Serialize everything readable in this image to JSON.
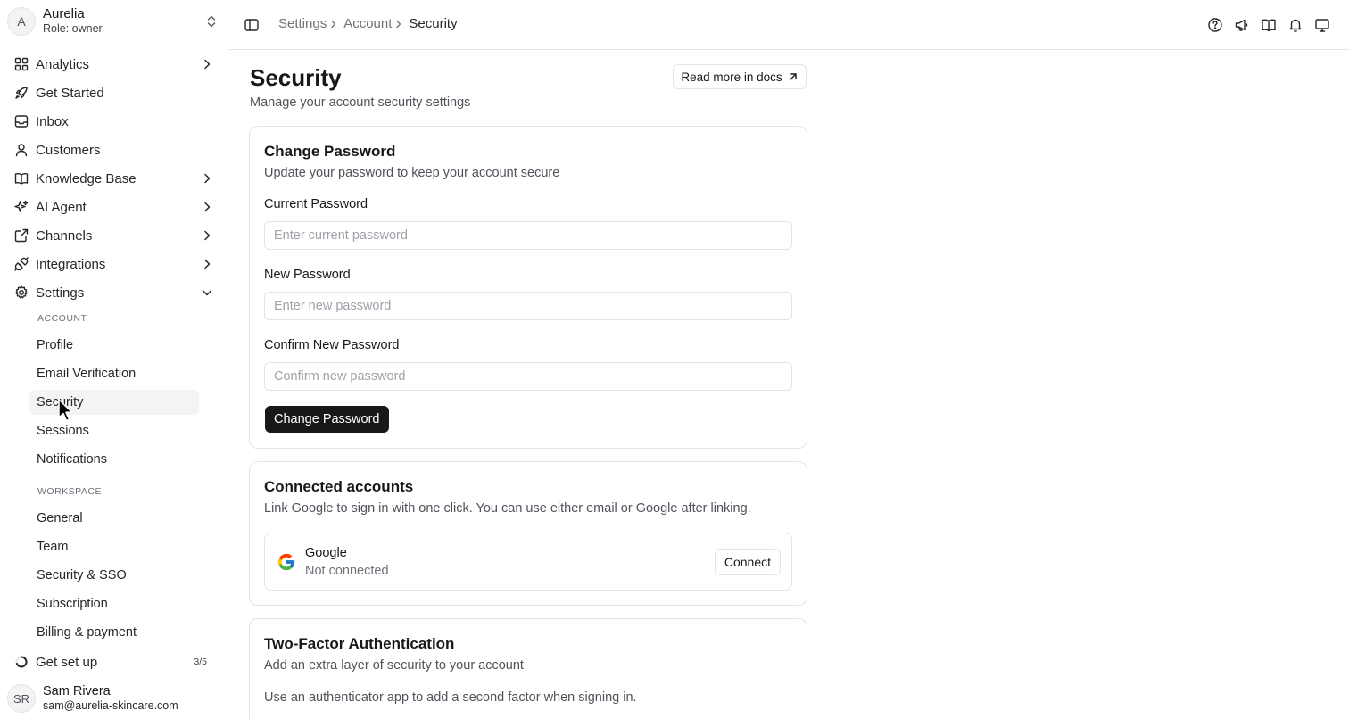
{
  "workspace": {
    "avatar_letter": "A",
    "name": "Aurelia",
    "role": "Role: owner"
  },
  "sidebar": {
    "items": [
      {
        "label": "Analytics",
        "icon": "grid-icon",
        "has_caret": true
      },
      {
        "label": "Get Started",
        "icon": "rocket-icon"
      },
      {
        "label": "Inbox",
        "icon": "inbox-icon"
      },
      {
        "label": "Customers",
        "icon": "user-icon"
      },
      {
        "label": "Knowledge Base",
        "icon": "book-icon",
        "has_caret": true
      },
      {
        "label": "AI Agent",
        "icon": "sparkles-icon",
        "has_caret": true
      },
      {
        "label": "Channels",
        "icon": "share-icon",
        "has_caret": true
      },
      {
        "label": "Integrations",
        "icon": "plug-icon",
        "has_caret": true
      },
      {
        "label": "Settings",
        "icon": "gear-icon",
        "expanded": true
      }
    ],
    "settings_sections": [
      {
        "heading": "Account",
        "items": [
          "Profile",
          "Email Verification",
          "Security",
          "Sessions",
          "Notifications"
        ]
      },
      {
        "heading": "Workspace",
        "items": [
          "General",
          "Team",
          "Security & SSO",
          "Subscription",
          "Billing & payment"
        ]
      }
    ],
    "active_item": "Security",
    "setup": {
      "label": "Get set up",
      "progress": "3/5"
    },
    "user": {
      "initials": "SR",
      "name": "Sam Rivera",
      "email": "sam@aurelia-skincare.com"
    }
  },
  "breadcrumb": [
    "Settings",
    "Account",
    "Security"
  ],
  "topbar_icons": [
    "help-icon",
    "megaphone-icon",
    "book-open-icon",
    "bell-icon",
    "monitor-icon"
  ],
  "page": {
    "title": "Security",
    "subtitle": "Manage your account security settings",
    "docs_button": "Read more in docs"
  },
  "change_password": {
    "title": "Change Password",
    "description": "Update your password to keep your account secure",
    "fields": [
      {
        "label": "Current Password",
        "placeholder": "Enter current password"
      },
      {
        "label": "New Password",
        "placeholder": "Enter new password"
      },
      {
        "label": "Confirm New Password",
        "placeholder": "Confirm new password"
      }
    ],
    "button": "Change Password"
  },
  "connected_accounts": {
    "title": "Connected accounts",
    "description": "Link Google to sign in with one click. You can use either email or Google after linking.",
    "provider": {
      "name": "Google",
      "status": "Not connected",
      "button": "Connect"
    }
  },
  "two_factor": {
    "title": "Two-Factor Authentication",
    "description": "Add an extra layer of security to your account",
    "body": "Use an authenticator app to add a second factor when signing in."
  },
  "colors": {
    "primary": "#18181b",
    "border": "#e4e4e7",
    "muted": "#71717a",
    "active_bg": "#f4f4f5"
  }
}
